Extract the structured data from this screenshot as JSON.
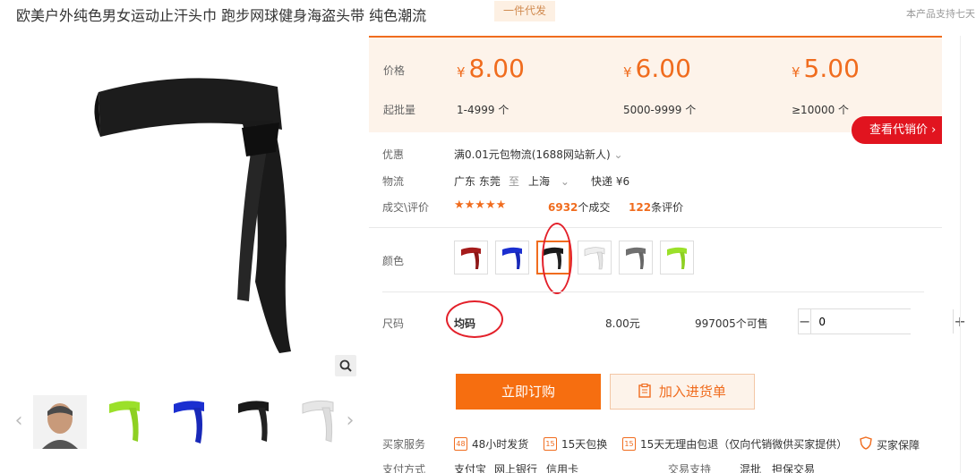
{
  "header": {
    "title": "欧美户外纯色男女运动止汗头巾 跑步网球健身海盗头带 纯色潮流",
    "tag": "一件代发",
    "notice": "本产品支持七天"
  },
  "prices": [
    {
      "label_price": "价格",
      "currency": "¥",
      "amount": "8.00",
      "range": "1-4999 个"
    },
    {
      "currency": "¥",
      "amount": "6.00",
      "range": "5000-9999 个"
    },
    {
      "currency": "¥",
      "amount": "5.00",
      "range": "≥10000 个"
    }
  ],
  "labels": {
    "price": "价格",
    "min_qty": "起批量",
    "discount": "优惠",
    "logistics": "物流",
    "deals": "成交\\评价",
    "color": "颜色",
    "size": "尺码",
    "service": "买家服务",
    "payment": "支付方式",
    "trade_support": "交易支持"
  },
  "agent_button": "查看代销价",
  "discount": "满0.01元包物流(1688网站新人)",
  "logistics": {
    "from": "广东 东莞",
    "to_word": "至",
    "to": "上海",
    "express": "快递 ¥6"
  },
  "deals": {
    "stars": "★★★★★",
    "count": "6932",
    "count_suffix": "个成交",
    "reviews": "122",
    "reviews_suffix": "条评价"
  },
  "colors": [
    {
      "name": "red",
      "hex": "#a51c1c"
    },
    {
      "name": "blue",
      "hex": "#1b2fd0"
    },
    {
      "name": "black",
      "hex": "#1a1a1a",
      "selected": true
    },
    {
      "name": "white",
      "hex": "#e8e8e8"
    },
    {
      "name": "gray",
      "hex": "#707070"
    },
    {
      "name": "lime",
      "hex": "#9be02a"
    }
  ],
  "size": {
    "value": "均码",
    "price": "8.00元",
    "stock": "997005个可售",
    "quantity": "0"
  },
  "buttons": {
    "order": "立即订购",
    "cart": "加入进货单"
  },
  "services": [
    {
      "icon": "48",
      "text": "48小时发货"
    },
    {
      "icon": "15",
      "text": "15天包换"
    },
    {
      "icon": "15",
      "text": "15天无理由包退（仅向代销微供买家提供）"
    },
    {
      "icon": "shield",
      "text": "买家保障"
    }
  ],
  "payment": [
    "支付宝",
    "网上银行",
    "信用卡"
  ],
  "trade_support": [
    "混批",
    "担保交易"
  ],
  "thumbnails": [
    "model",
    "lime",
    "blue",
    "black",
    "white"
  ]
}
